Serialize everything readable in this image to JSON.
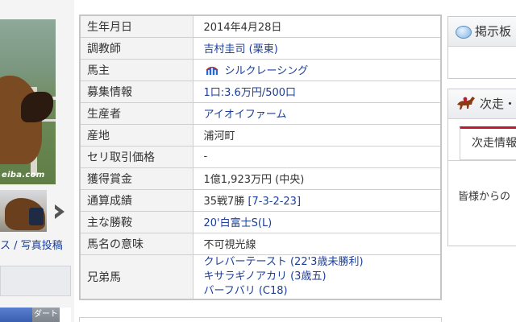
{
  "left": {
    "watermark": "eiba.com",
    "link_photo_list": "ス",
    "link_separator": "/",
    "link_photo_post": "写真投稿",
    "tab_dirt": "ダート"
  },
  "profile": {
    "rows": [
      {
        "label": "生年月日",
        "value": "2014年4月28日"
      },
      {
        "label": "調教師",
        "value": "吉村圭司 (栗東)"
      },
      {
        "label": "馬主",
        "value": "シルクレーシング"
      },
      {
        "label": "募集情報",
        "value": "1口:3.6万円/500口"
      },
      {
        "label": "生産者",
        "value": "アイオイファーム"
      },
      {
        "label": "産地",
        "value": "浦河町"
      },
      {
        "label": "セリ取引価格",
        "value": "-"
      },
      {
        "label": "獲得賞金",
        "value": "1億1,923万円 (中央)"
      },
      {
        "label": "通算成績",
        "value_prefix": "35戦7勝 ",
        "value_link": "[7-3-2-23]"
      },
      {
        "label": "主な勝鞍",
        "value": "20'白富士S(L)"
      },
      {
        "label": "馬名の意味",
        "value": "不可視光線"
      },
      {
        "label": "兄弟馬",
        "values": [
          "クレバーテースト (22'3歳未勝利)",
          "キサラギノアカリ (3歳五)",
          "バーフバリ (C18)"
        ]
      }
    ]
  },
  "right": {
    "board_title": "掲示板",
    "next_race_title": "次走・",
    "next_race_tab": "次走情報",
    "message": "皆様からの"
  },
  "colors": {
    "link": "#1a3e9a",
    "tab_accent": "#c0182c",
    "label_bg": "#f3f3f3"
  }
}
